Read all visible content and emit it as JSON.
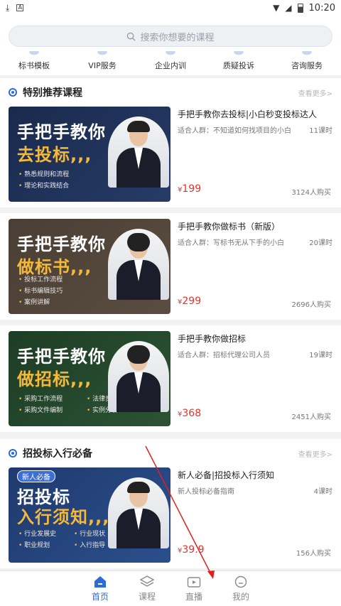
{
  "status_bar": {
    "time": "10:20"
  },
  "search": {
    "placeholder": "搜索你想要的课程"
  },
  "quick_nav": [
    {
      "label": "标书模板"
    },
    {
      "label": "VIP服务"
    },
    {
      "label": "企业内训"
    },
    {
      "label": "质疑投诉"
    },
    {
      "label": "咨询服务"
    }
  ],
  "sections": [
    {
      "title": "特别推荐课程",
      "more": "查看更多>",
      "courses": [
        {
          "thumb_line1": "手把手教你",
          "thumb_line2": "去投标,,,",
          "thumb_bullets": [
            "熟悉规则和流程",
            "理论和实践结合"
          ],
          "title": "手把手教你去投标|小白秒变投标达人",
          "audience": "适合人群：不知道如何找项目的小白",
          "lessons": "11课时",
          "price_symbol": "¥",
          "price_value": "199",
          "buyers": "3124人购买"
        },
        {
          "thumb_line1": "手把手教你",
          "thumb_line2": "做标书,,,",
          "thumb_bullets": [
            "投标工作流程",
            "标书编辑技巧",
            "案例讲解"
          ],
          "title": "手把手教你做标书（新版）",
          "audience": "适合人群：写标书无从下手的小白",
          "lessons": "20课时",
          "price_symbol": "¥",
          "price_value": "299",
          "buyers": "2696人购买"
        },
        {
          "thumb_line1": "手把手教你",
          "thumb_line2": "做招标,,,",
          "thumb_bullets": [
            "采购工作流程",
            "采购文件编制"
          ],
          "thumb_bullets2": [
            "法律责任",
            "实例分析"
          ],
          "title": "手把手教你做招标",
          "audience": "适合人群：招标代理公司人员",
          "lessons": "19课时",
          "price_symbol": "¥",
          "price_value": "368",
          "buyers": "2451人购买"
        }
      ]
    },
    {
      "title": "招投标入行必备",
      "more": "查看更多>",
      "courses": [
        {
          "badge": "新人必备",
          "thumb_line1": "招投标",
          "thumb_line2": "入行须知,,,",
          "thumb_bullets": [
            "行业发展史",
            "职业规划"
          ],
          "thumb_bullets2": [
            "行业现状",
            "入行指导"
          ],
          "title": "新人必备|招投标入行须知",
          "audience": "新人投标必备指南",
          "lessons": "4课时",
          "price_symbol": "¥",
          "price_value": "39.9",
          "buyers": "156人购买"
        }
      ]
    }
  ],
  "tabbar": [
    {
      "label": "首页",
      "icon": "home-icon",
      "active": true
    },
    {
      "label": "课程",
      "icon": "layers-icon",
      "active": false
    },
    {
      "label": "直播",
      "icon": "tv-play-icon",
      "active": false
    },
    {
      "label": "我的",
      "icon": "user-icon",
      "active": false
    }
  ],
  "colors": {
    "accent": "#2c6bd8",
    "price": "#e5322d",
    "annotation_arrow": "#e02020"
  }
}
